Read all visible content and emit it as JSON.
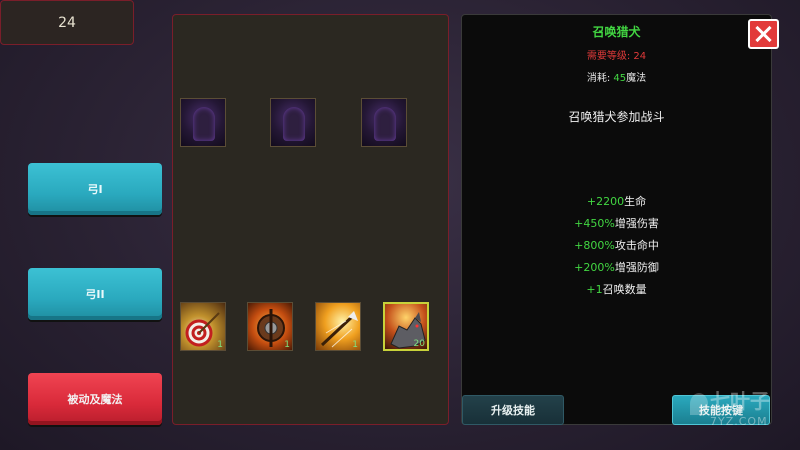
{
  "left": {
    "level_value": "24",
    "buttons": [
      {
        "label": "弓I"
      },
      {
        "label": "弓II"
      },
      {
        "label": "被动及魔法"
      }
    ]
  },
  "grid": {
    "locked_slots": [
      "locked-skill-icon",
      "locked-skill-icon",
      "locked-skill-icon"
    ],
    "skills": [
      {
        "icon": "target-bow-icon",
        "count": "1"
      },
      {
        "icon": "shield-bow-icon",
        "count": "1"
      },
      {
        "icon": "arrow-burst-icon",
        "count": "1"
      },
      {
        "icon": "hound-icon",
        "count": "20"
      }
    ]
  },
  "detail": {
    "title": "召唤猎犬",
    "req_label": "需要等级: ",
    "req_value": "24",
    "cost_label": "消耗: ",
    "cost_value": "45",
    "cost_unit": "魔法",
    "description": "召唤猎犬参加战斗",
    "stats": [
      {
        "value": "+2200",
        "suffix": "生命"
      },
      {
        "value": "+450%",
        "suffix": "增强伤害"
      },
      {
        "value": "+800%",
        "suffix": "攻击命中"
      },
      {
        "value": "+200%",
        "suffix": "增强防御"
      },
      {
        "value": "+1",
        "suffix": "召唤数量"
      }
    ],
    "upgrade_label": "升级技能",
    "keybind_label": "技能按键"
  },
  "watermark": {
    "main": "七叶子",
    "sub": "7YZ.COM"
  },
  "colors": {
    "accent_green": "#42d642",
    "accent_red": "#e03a3a",
    "button_cyan": "#2aa9be",
    "button_red": "#d92a3a"
  }
}
